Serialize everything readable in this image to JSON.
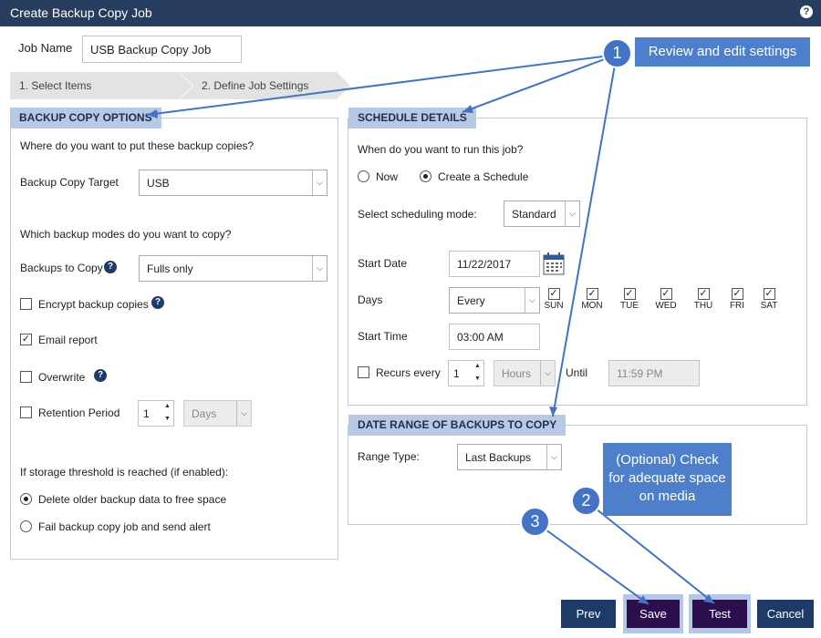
{
  "window": {
    "title": "Create Backup Copy Job",
    "help_label": "?"
  },
  "job": {
    "name_label": "Job Name",
    "name_value": "USB Backup Copy Job"
  },
  "steps": [
    {
      "label": "1. Select Items"
    },
    {
      "label": "2. Define Job Settings"
    }
  ],
  "backup_options": {
    "title": "BACKUP COPY OPTIONS",
    "where_question": "Where do you want to put these backup copies?",
    "target_label": "Backup Copy Target",
    "target_value": "USB",
    "modes_question": "Which backup modes do you want to copy?",
    "backups_to_copy_label": "Backups to Copy",
    "backups_to_copy_value": "Fulls only",
    "encrypt_label": "Encrypt backup copies",
    "encrypt_checked": false,
    "email_label": "Email report",
    "email_checked": true,
    "email_check_mark": "✓",
    "overwrite_label": "Overwrite",
    "retention_label": "Retention Period",
    "retention_value": "1",
    "retention_unit": "Days",
    "threshold_question": "If storage threshold is reached (if enabled):",
    "threshold_opt1": "Delete older backup data to free space",
    "threshold_opt2": "Fail backup copy job and send alert"
  },
  "schedule": {
    "title": "SCHEDULE DETAILS",
    "when_question": "When do you want to run this job?",
    "now_label": "Now",
    "create_label": "Create a Schedule",
    "mode_label": "Select scheduling mode:",
    "mode_value": "Standard",
    "start_date_label": "Start Date",
    "start_date_value": "11/22/2017",
    "days_label": "Days",
    "days_value": "Every",
    "days": [
      "SUN",
      "MON",
      "TUE",
      "WED",
      "THU",
      "FRI",
      "SAT"
    ],
    "day_check_mark": "✓",
    "start_time_label": "Start Time",
    "start_time_value": "03:00 AM",
    "recurs_label": "Recurs every",
    "recurs_value": "1",
    "recurs_unit": "Hours",
    "until_label": "Until",
    "until_value": "11:59 PM"
  },
  "date_range": {
    "title": "DATE RANGE OF BACKUPS TO COPY",
    "range_type_label": "Range Type:",
    "range_type_value": "Last Backups"
  },
  "buttons": {
    "prev": "Prev",
    "save": "Save",
    "test": "Test",
    "cancel": "Cancel"
  },
  "annotations": {
    "callout1": "Review and edit settings",
    "callout2": "(Optional) Check for adequate space on media",
    "badge1": "1",
    "badge2": "2",
    "badge3": "3",
    "color": "#4472c4"
  },
  "colors": {
    "titlebar": "#273d5f",
    "section_header": "#b7c9e5",
    "button_dark": "#1e3a66",
    "button_purple": "#2b0f4d"
  }
}
